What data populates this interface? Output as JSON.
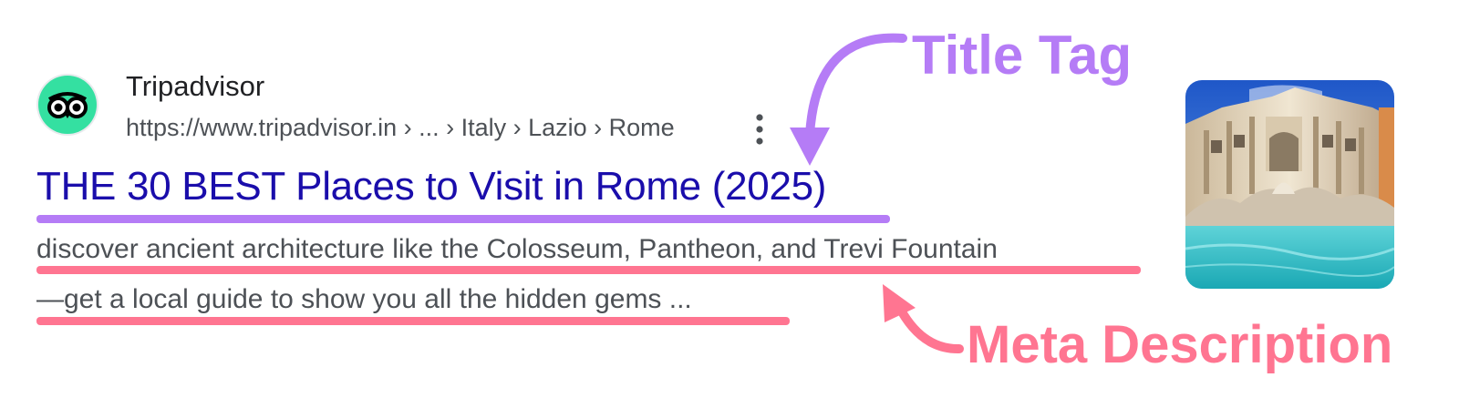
{
  "result": {
    "site_name": "Tripadvisor",
    "url": "https://www.tripadvisor.in › ... › Italy › Lazio › Rome",
    "title": "THE 30 BEST Places to Visit in Rome (2025)",
    "description_line1": "discover ancient architecture like the Colosseum, Pantheon, and Trevi Fountain",
    "description_line2": "—get a local guide to show you all the hidden gems ...",
    "favicon_icon": "tripadvisor-owl-logo",
    "thumbnail_icon": "trevi-fountain-photo",
    "more_icon": "vertical-dots-icon"
  },
  "annotations": {
    "title_tag": "Title Tag",
    "meta_description": "Meta Description"
  },
  "colors": {
    "title_link": "#1a0dab",
    "title_tag_accent": "#b57cf6",
    "meta_description_accent": "#ff7591",
    "favicon_green": "#34e0a1"
  }
}
